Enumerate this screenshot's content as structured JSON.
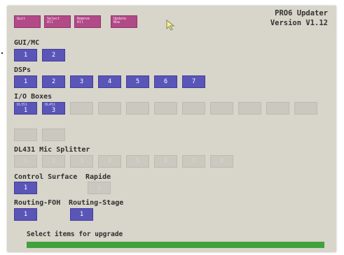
{
  "toolbar": [
    {
      "label": "Quit"
    },
    {
      "label": "Select All"
    },
    {
      "label": "Remove All"
    },
    {
      "label": "Update Now"
    }
  ],
  "header": {
    "app_name": "PRO6 Updater",
    "version": "Version V1.12"
  },
  "sections": {
    "gui_mc": {
      "label": "GUI/MC",
      "buttons": [
        "1",
        "2"
      ]
    },
    "dsps": {
      "label": "DSPs",
      "buttons": [
        "1",
        "2",
        "3",
        "4",
        "5",
        "6",
        "7"
      ]
    },
    "io_boxes": {
      "label": "I/O Boxes",
      "active": [
        {
          "sub": "DL351",
          "num": "1"
        },
        {
          "sub": "DL451",
          "num": "3"
        }
      ]
    },
    "dl431": {
      "label": "DL431 Mic Splitter",
      "buttons": [
        "1",
        "2",
        "3",
        "4",
        "5",
        "6",
        "7",
        "8"
      ]
    },
    "control_surface": {
      "label": "Control Surface",
      "buttons": [
        "1"
      ]
    },
    "rapide": {
      "label": "Rapide",
      "buttons": [
        "1"
      ]
    },
    "routing_foh": {
      "label": "Routing-FOH",
      "buttons": [
        "1"
      ]
    },
    "routing_stage": {
      "label": "Routing-Stage",
      "buttons": [
        "1"
      ]
    }
  },
  "status": {
    "text": "Select items for upgrade",
    "progress": 1.0,
    "color": "#3fa23a"
  },
  "colors": {
    "button": "#5a56b8",
    "toolbar": "#b24a88",
    "background": "#d8d5cb"
  }
}
